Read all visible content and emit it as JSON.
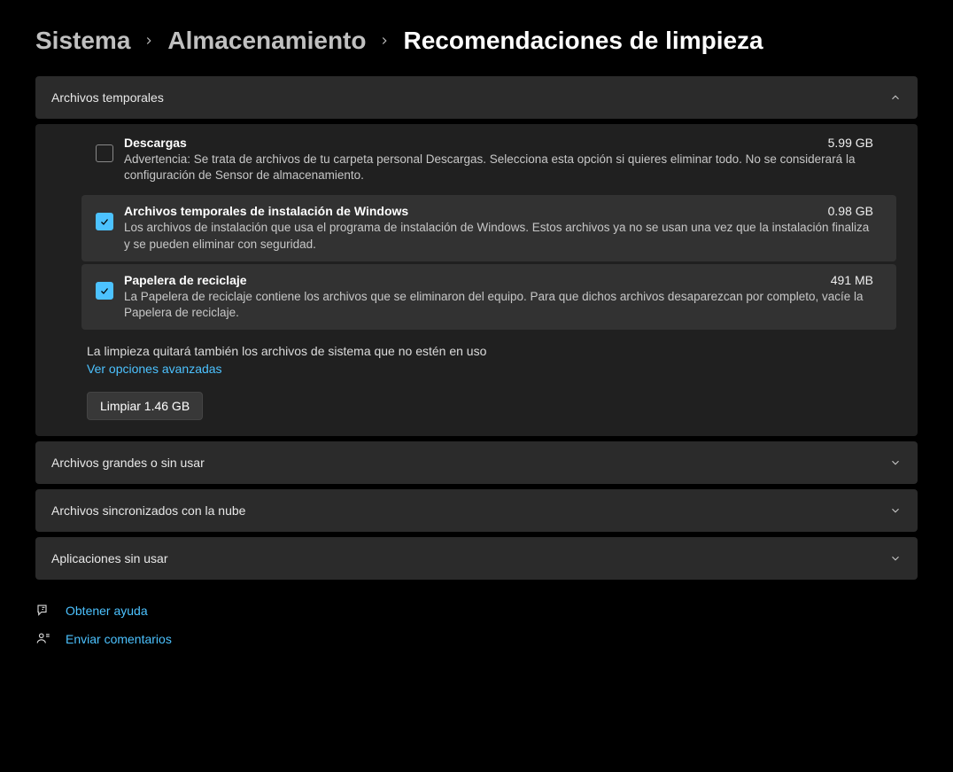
{
  "breadcrumb": {
    "system": "Sistema",
    "storage": "Almacenamiento",
    "current": "Recomendaciones de limpieza"
  },
  "sections": {
    "temp": {
      "title": "Archivos temporales",
      "items": [
        {
          "name": "Descargas",
          "size": "5.99 GB",
          "desc": "Advertencia: Se trata de archivos de tu carpeta personal Descargas. Selecciona esta opción si quieres eliminar todo. No se considerará la configuración de Sensor de almacenamiento.",
          "checked": false
        },
        {
          "name": "Archivos temporales de instalación de Windows",
          "size": "0.98 GB",
          "desc": "Los archivos de instalación que usa el programa de instalación de Windows. Estos archivos ya no se usan una vez que la instalación finaliza y se pueden eliminar con seguridad.",
          "checked": true
        },
        {
          "name": "Papelera de reciclaje",
          "size": "491 MB",
          "desc": "La Papelera de reciclaje contiene los archivos que se eliminaron del equipo. Para que dichos archivos desaparezcan por completo, vacíe la Papelera de reciclaje.",
          "checked": true
        }
      ],
      "note": "La limpieza quitará también los archivos de sistema que no estén en uso",
      "advanced": "Ver opciones avanzadas",
      "clean_button": "Limpiar 1.46 GB"
    },
    "large": {
      "title": "Archivos grandes o sin usar"
    },
    "cloud": {
      "title": "Archivos sincronizados con la nube"
    },
    "apps": {
      "title": "Aplicaciones sin usar"
    }
  },
  "footer": {
    "help": "Obtener ayuda",
    "feedback": "Enviar comentarios"
  }
}
